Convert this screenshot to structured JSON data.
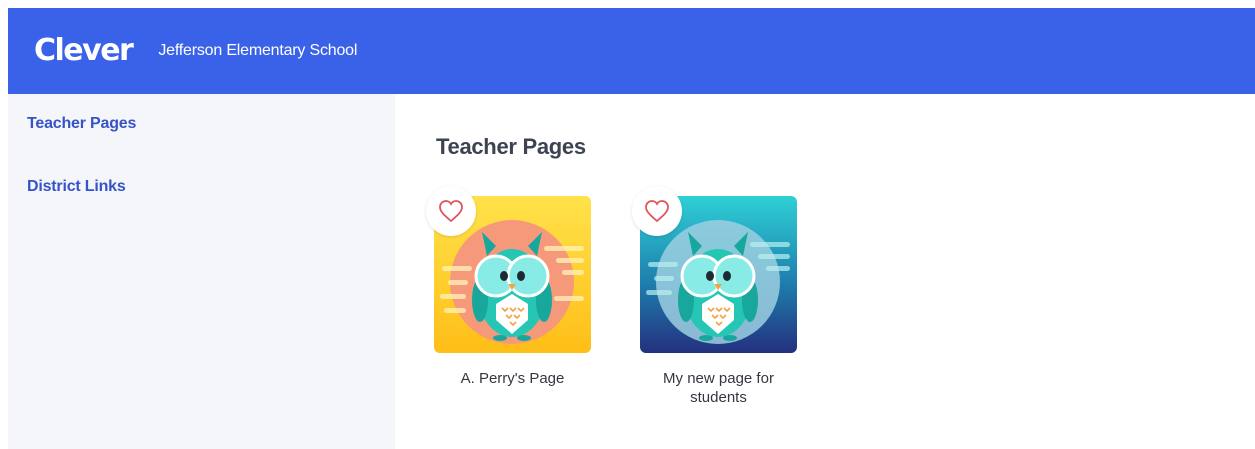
{
  "header": {
    "logo_text": "Clever",
    "school_name": "Jefferson Elementary School"
  },
  "sidebar": {
    "items": [
      {
        "label": "Teacher Pages"
      },
      {
        "label": "District Links"
      }
    ]
  },
  "main": {
    "title": "Teacher Pages",
    "cards": [
      {
        "label": "A. Perry's Page",
        "icon": "owl-icon",
        "favorite_icon": "heart-outline-icon",
        "theme": "yellow"
      },
      {
        "label": "My new page for students",
        "icon": "owl-icon",
        "favorite_icon": "heart-outline-icon",
        "theme": "teal"
      }
    ]
  },
  "colors": {
    "header_bg": "#3a62e8",
    "sidebar_bg": "#f5f6f9",
    "nav_link": "#3653c8",
    "heart": "#e0535c"
  }
}
